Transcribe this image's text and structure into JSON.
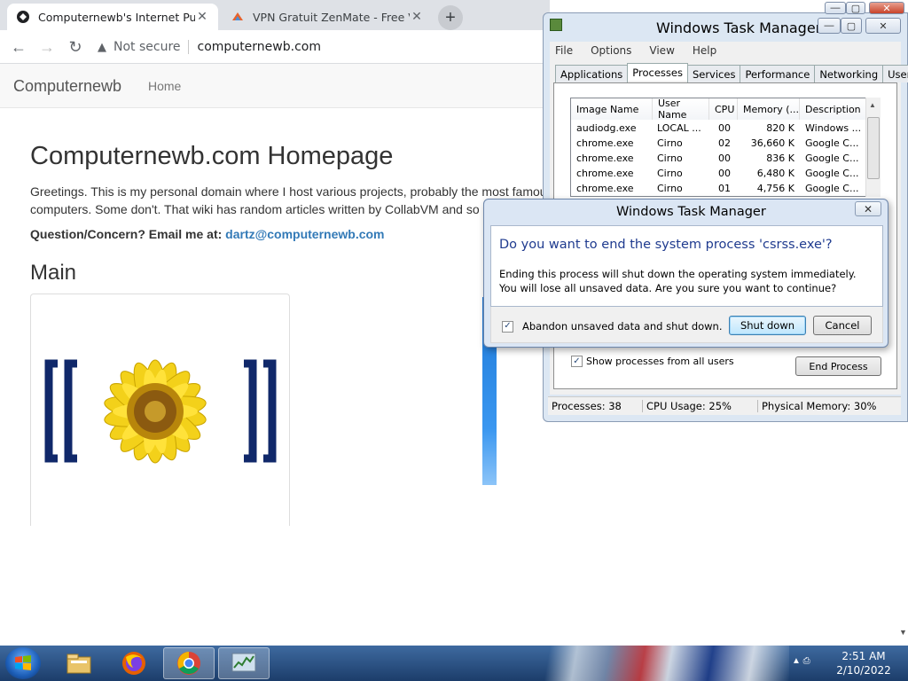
{
  "browser": {
    "tabs": [
      {
        "title": "Computernewb's Internet Pub H"
      },
      {
        "title": "VPN Gratuit ZenMate - Free VPN"
      }
    ],
    "security_label": "Not secure",
    "url": "computernewb.com"
  },
  "site": {
    "brand": "Computernewb",
    "nav_home": "Home",
    "heading": "Computernewb.com Homepage",
    "intro_line1": "Greetings. This is my personal domain where I host various projects, probably the most famou",
    "intro_line2": "computers. Some don't. That wiki has random articles written by CollabVM and so",
    "contact_label": "Question/Concern? Email me at:",
    "contact_email": "dartz@computernewb.com",
    "section_main": "Main"
  },
  "taskmgr": {
    "title": "Windows Task Manager",
    "menu": [
      "File",
      "Options",
      "View",
      "Help"
    ],
    "tabs": [
      "Applications",
      "Processes",
      "Services",
      "Performance",
      "Networking",
      "Users"
    ],
    "active_tab": "Processes",
    "columns": [
      "Image Name",
      "User Name",
      "CPU",
      "Memory (...",
      "Description"
    ],
    "rows": [
      {
        "image": "audiodg.exe",
        "user": "LOCAL ...",
        "cpu": "00",
        "mem": "820 K",
        "desc": "Windows ..."
      },
      {
        "image": "chrome.exe",
        "user": "Cirno",
        "cpu": "02",
        "mem": "36,660 K",
        "desc": "Google C..."
      },
      {
        "image": "chrome.exe",
        "user": "Cirno",
        "cpu": "00",
        "mem": "836 K",
        "desc": "Google C..."
      },
      {
        "image": "chrome.exe",
        "user": "Cirno",
        "cpu": "00",
        "mem": "6,480 K",
        "desc": "Google C..."
      },
      {
        "image": "chrome.exe",
        "user": "Cirno",
        "cpu": "01",
        "mem": "4,756 K",
        "desc": "Google C..."
      }
    ],
    "show_all_label": "Show processes from all users",
    "show_all_checked": true,
    "end_process_label": "End Process",
    "status": {
      "processes": "Processes: 38",
      "cpu": "CPU Usage: 25%",
      "memory": "Physical Memory: 30%"
    }
  },
  "dialog": {
    "title": "Windows Task Manager",
    "question": "Do you want to end the system process 'csrss.exe'?",
    "description": "Ending this process will shut down the operating system immediately.  You will lose all unsaved data.  Are you sure you want to continue?",
    "checkbox_label": "Abandon unsaved data and shut down.",
    "checkbox_checked": true,
    "confirm_label": "Shut down",
    "cancel_label": "Cancel"
  },
  "taskbar": {
    "time": "2:51 AM",
    "date": "2/10/2022"
  }
}
